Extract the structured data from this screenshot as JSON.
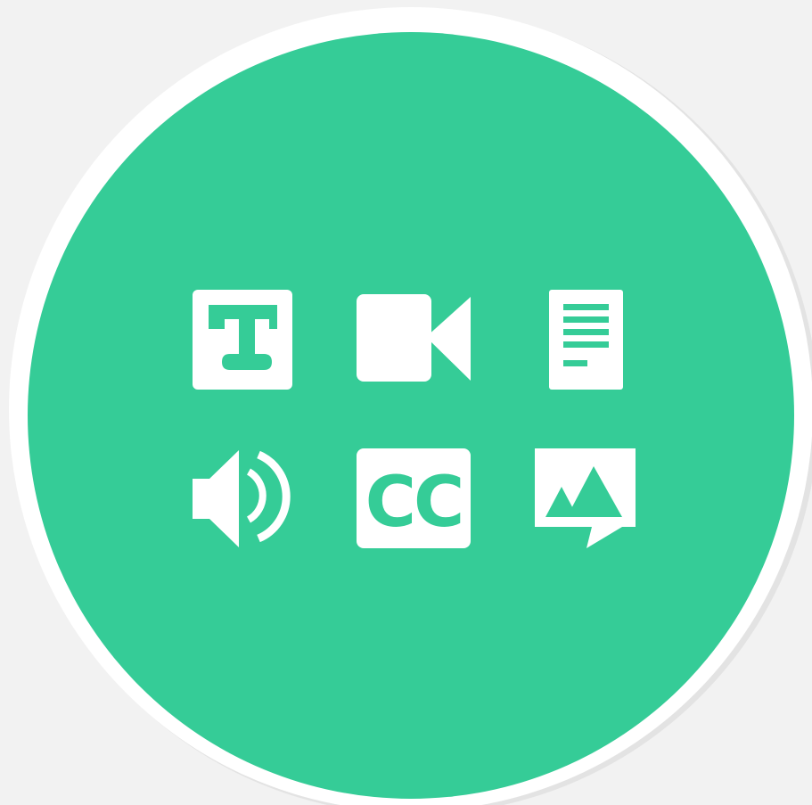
{
  "colors": {
    "background": "#f2f2f2",
    "ring": "#ffffff",
    "ring_shadow": "#e3e3e3",
    "disc": "#35cc97",
    "glyph": "#ffffff"
  },
  "caption_icon": {
    "text": "CC"
  },
  "icons": [
    {
      "name": "text-icon",
      "row": 1,
      "column": 1
    },
    {
      "name": "video-camera-icon",
      "row": 1,
      "column": 2
    },
    {
      "name": "document-icon",
      "row": 1,
      "column": 3
    },
    {
      "name": "speaker-icon",
      "row": 2,
      "column": 1
    },
    {
      "name": "closed-captions-icon",
      "row": 2,
      "column": 2
    },
    {
      "name": "image-description-icon",
      "row": 2,
      "column": 3
    }
  ]
}
